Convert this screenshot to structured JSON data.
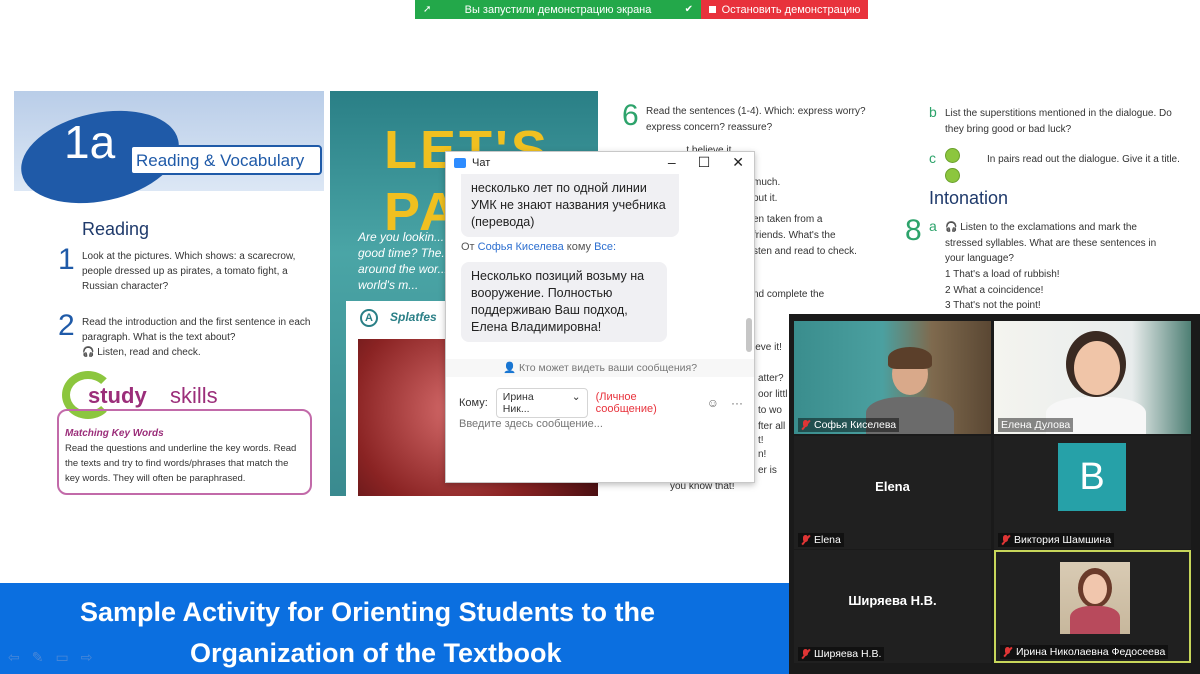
{
  "share_bar": {
    "sharing_text": "Вы запустили демонстрацию экрана",
    "stop_label": "Остановить демонстрацию"
  },
  "page1": {
    "lesson_number": "1a",
    "lesson_title": "Reading & Vocabulary",
    "section_heading": "Reading",
    "ex1_num": "1",
    "ex1_text": "Look at the pictures. Which shows: a scarecrow, people dressed up as pirates, a tomato fight, a Russian character?",
    "ex2_num": "2",
    "ex2_text": "Read the introduction and the first sentence in each paragraph. What is the text about?",
    "ex2_listen": "Listen, read and check.",
    "study_word": "study",
    "skills_word": "skills",
    "skill_heading": "Matching Key Words",
    "skill_text": "Read the questions and underline the key words. Read the texts and try to find words/phrases that match the key words. They will often be paraphrased."
  },
  "page2": {
    "big_letters": "LET'S PA",
    "text": "Are you lookin... good time? The... around the wor... world's m...",
    "section_badge": "A",
    "section_title": "Splatfes"
  },
  "page3": {
    "ex6_num": "6",
    "ex6_text": "Read the sentences (1-4). Which: express worry? express concern? reassure?",
    "lines": [
      "...t believe it.",
      "much.",
      "out it.",
      "en taken from a",
      "friends. What's the",
      "sten and read to check.",
      "nd complete the",
      "ieve it!",
      "atter?",
      "oor littl",
      "to wo",
      "fter all",
      "t!",
      "n!",
      "er is",
      "you know that!"
    ]
  },
  "page4": {
    "b_label": "b",
    "b_text": "List the superstitions mentioned in the dialogue. Do they bring good or bad luck?",
    "c_label": "c",
    "c_text": "In pairs read out the dialogue. Give it a title.",
    "intonation": "Intonation",
    "ex8_num": "8",
    "ex8_a": "a",
    "ex8_text": "Listen to the exclamations and mark the stressed syllables. What are these sentences in your language?",
    "items": [
      "1   That's a load of rubbish!",
      "2   What a coincidence!",
      "3   That's not the point!"
    ]
  },
  "slide_title": {
    "line1": "Sample Activity for Orienting Students to the",
    "line2": "Organization of the Textbook"
  },
  "chat": {
    "title": "Чат",
    "msg1": "несколько лет по одной линии УМК не знают названия учебника (перевода)",
    "from_prefix": "От",
    "from_name": "Софья Киселева",
    "to_word": "кому",
    "to_all": "Все:",
    "msg2": "Несколько позиций возьму на вооружение. Полностью поддерживаю Ваш подход, Елена Владимировна!",
    "who_can_see": "Кто может видеть ваши сообщения?",
    "to_label": "Кому:",
    "recipient": "Ирина Ник...",
    "private_label": "(Личное сообщение)",
    "input_placeholder": "Введите здесь сообщение..."
  },
  "video": {
    "participants": [
      {
        "name": "Софья Киселева"
      },
      {
        "name": "Елена Дулова"
      },
      {
        "name": "Elena",
        "center": "Elena"
      },
      {
        "name": "Виктория Шамшина",
        "initial": "В"
      },
      {
        "name": "Ширяева Н.В.",
        "center": "Ширяева Н.В."
      },
      {
        "name": "Ирина Николаевна Федосеева"
      }
    ]
  },
  "colors": {
    "share_green": "#23a84a",
    "share_red": "#e8323c",
    "title_blue": "#0b6fe0",
    "zoom_blue": "#2d8cff"
  }
}
